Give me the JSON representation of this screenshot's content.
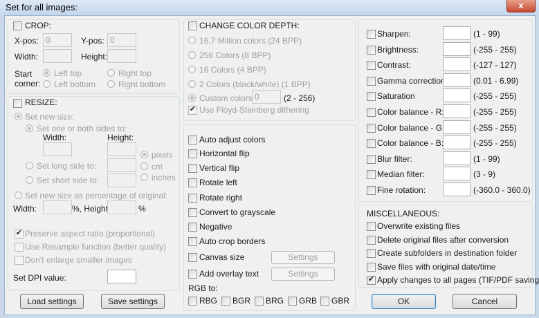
{
  "window": {
    "title": "Set for all images:",
    "close": "x"
  },
  "crop": {
    "header": "CROP:",
    "xpos": "X-pos:",
    "xpos_value": "0",
    "ypos": "Y-pos:",
    "ypos_value": "0",
    "width": "Width:",
    "height": "Height:",
    "start": "Start",
    "corner": "corner:",
    "left_top": "Left top",
    "right_top": "Right top",
    "left_bottom": "Left bottom",
    "right_bottom": "Right bottom"
  },
  "resize": {
    "header": "RESIZE:",
    "set_new_size": "Set new size:",
    "one_or_both": "Set one or both sides to:",
    "width": "Width:",
    "height": "Height:",
    "pixels": "pixels",
    "cm": "cm",
    "inches": "inches",
    "long_side": "Set long side to:",
    "short_side": "Set short side to:",
    "percentage": "Set new size as percentage of original:",
    "pct_width": "Width:",
    "pct_height": "%, Height:",
    "pct_sign": "%",
    "preserve": "Preserve aspect ratio (proportional)",
    "resample": "Use Resample function (better quality)",
    "dont_enlarge": "Don't enlarge smaller images",
    "dpi": "Set DPI value:"
  },
  "buttons": {
    "load": "Load settings",
    "save": "Save settings",
    "ok": "OK",
    "cancel": "Cancel",
    "settings": "Settings"
  },
  "color_depth": {
    "header": "CHANGE COLOR DEPTH:",
    "options": [
      "16,7 Million colors (24 BPP)",
      "256 Colors (8 BPP)",
      "16 Colors (4 BPP)",
      "2 Colors (black/white) (1 BPP)"
    ],
    "custom": "Custom colors:",
    "custom_value": "0",
    "custom_range": "(2 - 256)",
    "dithering": "Use Floyd-Steinberg dithering"
  },
  "effects": {
    "auto_adjust": "Auto adjust colors",
    "hflip": "Horizontal flip",
    "vflip": "Vertical flip",
    "rotate_left": "Rotate left",
    "rotate_right": "Rotate right",
    "grayscale": "Convert to grayscale",
    "negative": "Negative",
    "auto_crop": "Auto crop borders",
    "canvas": "Canvas size",
    "overlay": "Add overlay text",
    "rgb_to": "RGB to:",
    "rgb_options": [
      "RBG",
      "BGR",
      "BRG",
      "GRB",
      "GBR"
    ]
  },
  "adjustments": [
    {
      "label": "Sharpen:",
      "range": "(1  -  99)"
    },
    {
      "label": "Brightness:",
      "range": "(-255  -  255)"
    },
    {
      "label": "Contrast:",
      "range": "(-127  -  127)"
    },
    {
      "label": "Gamma correction:",
      "range": "(0.01  -  6.99)"
    },
    {
      "label": "Saturation",
      "range": "(-255  -  255)"
    },
    {
      "label": "Color balance - R:",
      "range": "(-255  -  255)"
    },
    {
      "label": "Color balance - G:",
      "range": "(-255  -  255)"
    },
    {
      "label": "Color balance - B:",
      "range": "(-255  -  255)"
    },
    {
      "label": "Blur filter:",
      "range": "(1  -  99)"
    },
    {
      "label": "Median filter:",
      "range": "(3  -  9)"
    },
    {
      "label": "Fine rotation:",
      "range": "(-360.0  -  360.0)"
    }
  ],
  "misc": {
    "header": "MISCELLANEOUS:",
    "items": [
      {
        "label": "Overwrite existing files",
        "checked": false
      },
      {
        "label": "Delete original files after conversion",
        "checked": false
      },
      {
        "label": "Create subfolders in destination folder",
        "checked": false
      },
      {
        "label": "Save files with original date/time",
        "checked": false
      },
      {
        "label": "Apply changes to all pages (TIF/PDF saving)",
        "checked": true
      }
    ],
    "checkmark": "✔"
  }
}
